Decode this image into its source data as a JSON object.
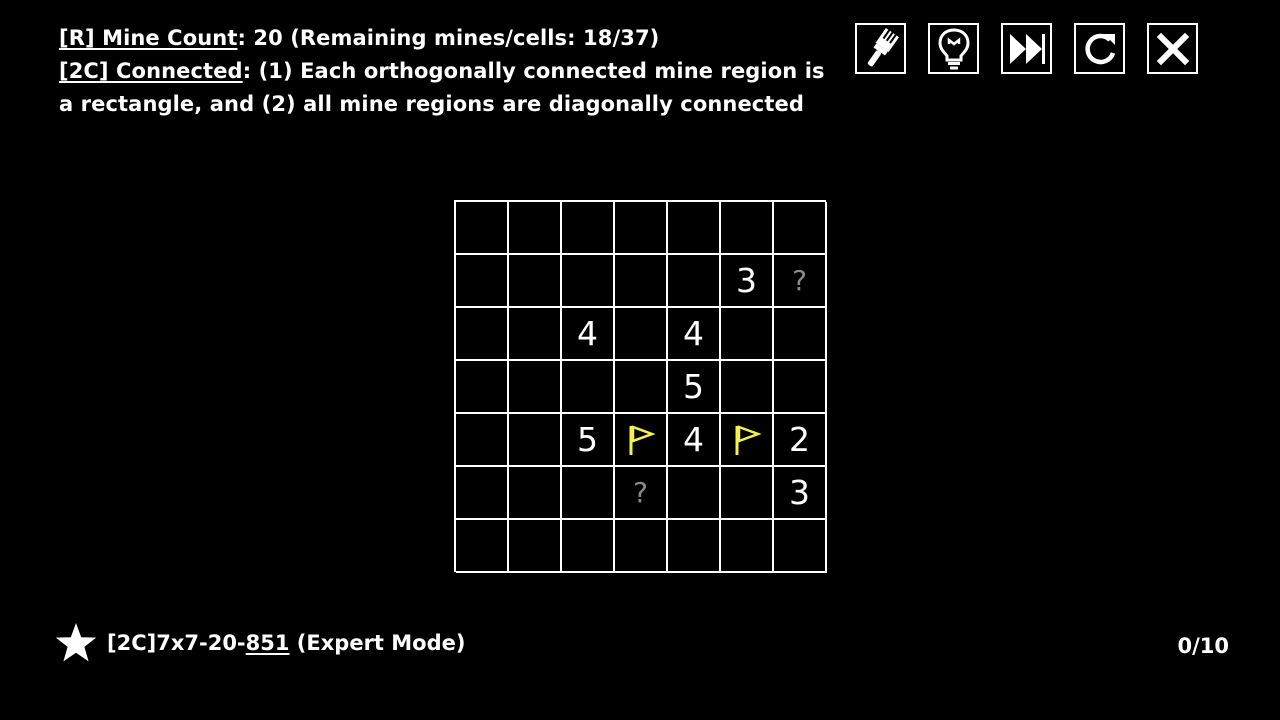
{
  "rules": {
    "line1": {
      "tag": "[R] Mine Count",
      "text": ":  20 (Remaining mines/cells: 18/37)"
    },
    "line2": {
      "tag": "[2C] Connected",
      "text": ": (1) Each orthogonally connected mine region is a rectangle, and (2) all mine regions are diagonally connected"
    }
  },
  "toolbar": [
    {
      "name": "paint-icon-button",
      "icon": "paintbrush-icon"
    },
    {
      "name": "hint-icon-button",
      "icon": "lightbulb-icon"
    },
    {
      "name": "skip-icon-button",
      "icon": "fast-forward-icon"
    },
    {
      "name": "restart-icon-button",
      "icon": "restart-icon"
    },
    {
      "name": "close-icon-button",
      "icon": "close-icon"
    }
  ],
  "board": {
    "rows": 7,
    "cols": 7,
    "colors": {
      "number": "#ffffff",
      "question": "#8a8a8a",
      "flag": "#f2f24a",
      "grid": "#ffffff"
    },
    "cells": [
      [
        "",
        "",
        "",
        "",
        "",
        "",
        ""
      ],
      [
        "",
        "",
        "",
        "",
        "",
        "3",
        "?"
      ],
      [
        "",
        "",
        "4",
        "",
        "4",
        "",
        ""
      ],
      [
        "",
        "",
        "",
        "",
        "5",
        "",
        ""
      ],
      [
        "",
        "",
        "5",
        "F",
        "4",
        "F",
        "2"
      ],
      [
        "",
        "",
        "",
        "?",
        "",
        "",
        "3"
      ],
      [
        "",
        "",
        "",
        "",
        "",
        "",
        ""
      ]
    ]
  },
  "footer": {
    "star_icon": "star-icon",
    "puzzle_prefix": "[2C]7x7-20-",
    "puzzle_number": "851",
    "puzzle_suffix": " (Expert Mode)",
    "progress": "0/10"
  }
}
